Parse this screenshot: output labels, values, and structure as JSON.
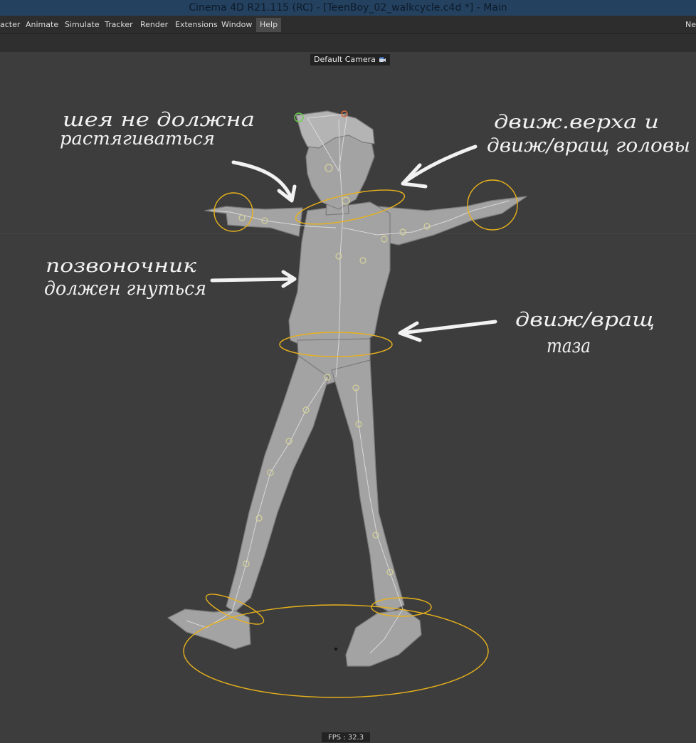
{
  "window": {
    "title": "Cinema 4D R21.115 (RC) - [TeenBoy_02_walkcycle.c4d *] - Main"
  },
  "menu": {
    "items": [
      {
        "label": "acter"
      },
      {
        "label": "Animate"
      },
      {
        "label": "Simulate"
      },
      {
        "label": "Tracker"
      },
      {
        "label": "Render"
      },
      {
        "label": "Extensions"
      },
      {
        "label": "Window"
      },
      {
        "label": "Help"
      }
    ],
    "right_label": "Ne"
  },
  "viewport": {
    "camera_label": "Default Camera",
    "fps": "FPS : 32.3"
  },
  "annotations": {
    "neck": [
      "шея не должна",
      "растягиваться"
    ],
    "upper_body": [
      "движ.верха и",
      "движ/вращ головы"
    ],
    "spine": [
      "позвоночник",
      "должен гнуться"
    ],
    "pelvis": [
      "движ/вращ",
      "таза"
    ]
  },
  "colors": {
    "controller": "#e8b21c",
    "model": "#9a9a9a",
    "handwriting": "#f2f2f2"
  }
}
